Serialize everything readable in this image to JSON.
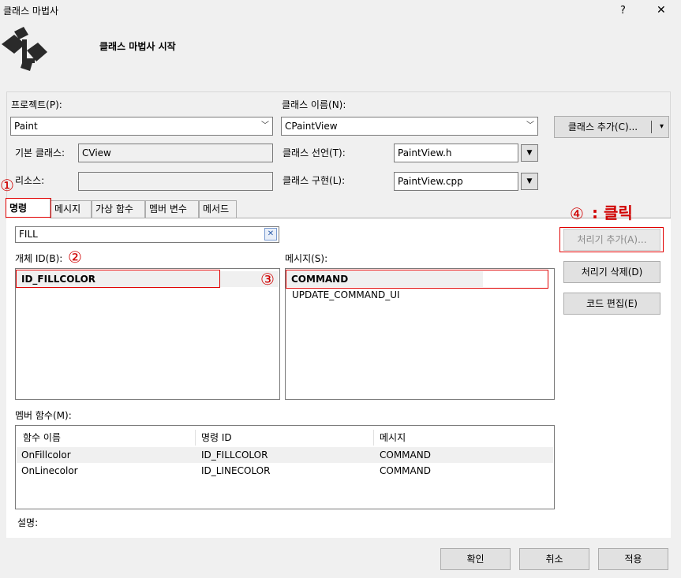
{
  "window": {
    "title": "클래스 마법사",
    "help_label": "?",
    "close_label": "✕"
  },
  "header": {
    "subtitle": "클래스 마법사 시작"
  },
  "project": {
    "label": "프로젝트(P):",
    "value": "Paint"
  },
  "class_name": {
    "label": "클래스 이름(N):",
    "value": "CPaintView"
  },
  "add_class_button": {
    "label": "클래스 추가(C)...",
    "arrow": "▾"
  },
  "base_class": {
    "label": "기본 클래스:",
    "value": "CView"
  },
  "resource": {
    "label": "리소스:",
    "value": ""
  },
  "class_declaration": {
    "label": "클래스 선언(T):",
    "value": "PaintView.h"
  },
  "class_implementation": {
    "label": "클래스 구현(L):",
    "value": "PaintView.cpp"
  },
  "tabs": [
    {
      "label": "명령"
    },
    {
      "label": "메시지"
    },
    {
      "label": "가상 함수"
    },
    {
      "label": "멤버 변수"
    },
    {
      "label": "메서드"
    }
  ],
  "search": {
    "value": "FILL",
    "clear_label": "✕"
  },
  "object_ids": {
    "label": "개체 ID(B):",
    "items": [
      "ID_FILLCOLOR"
    ]
  },
  "messages": {
    "label": "메시지(S):",
    "items": [
      "COMMAND",
      "UPDATE_COMMAND_UI"
    ]
  },
  "actions": {
    "add_handler": "처리기 추가(A)...",
    "delete_handler": "처리기 삭제(D)",
    "edit_code": "코드 편집(E)"
  },
  "member_functions": {
    "label": "멤버 함수(M):",
    "columns": [
      "함수 이름",
      "명령 ID",
      "메시지"
    ],
    "rows": [
      [
        "OnFillcolor",
        "ID_FILLCOLOR",
        "COMMAND"
      ],
      [
        "OnLinecolor",
        "ID_LINECOLOR",
        "COMMAND"
      ]
    ]
  },
  "description": {
    "label": "설명:"
  },
  "footer": {
    "ok": "확인",
    "cancel": "취소",
    "apply": "적용"
  },
  "annotations": {
    "step1": "①",
    "step2": "②",
    "step3": "③",
    "step4": "④",
    "step4_text": ": 클릭",
    "color": "#e00000"
  },
  "icons": {
    "wizard": "class-wizard-icon",
    "dropdown": "chevron-down-icon",
    "clear": "clear-search-icon"
  }
}
